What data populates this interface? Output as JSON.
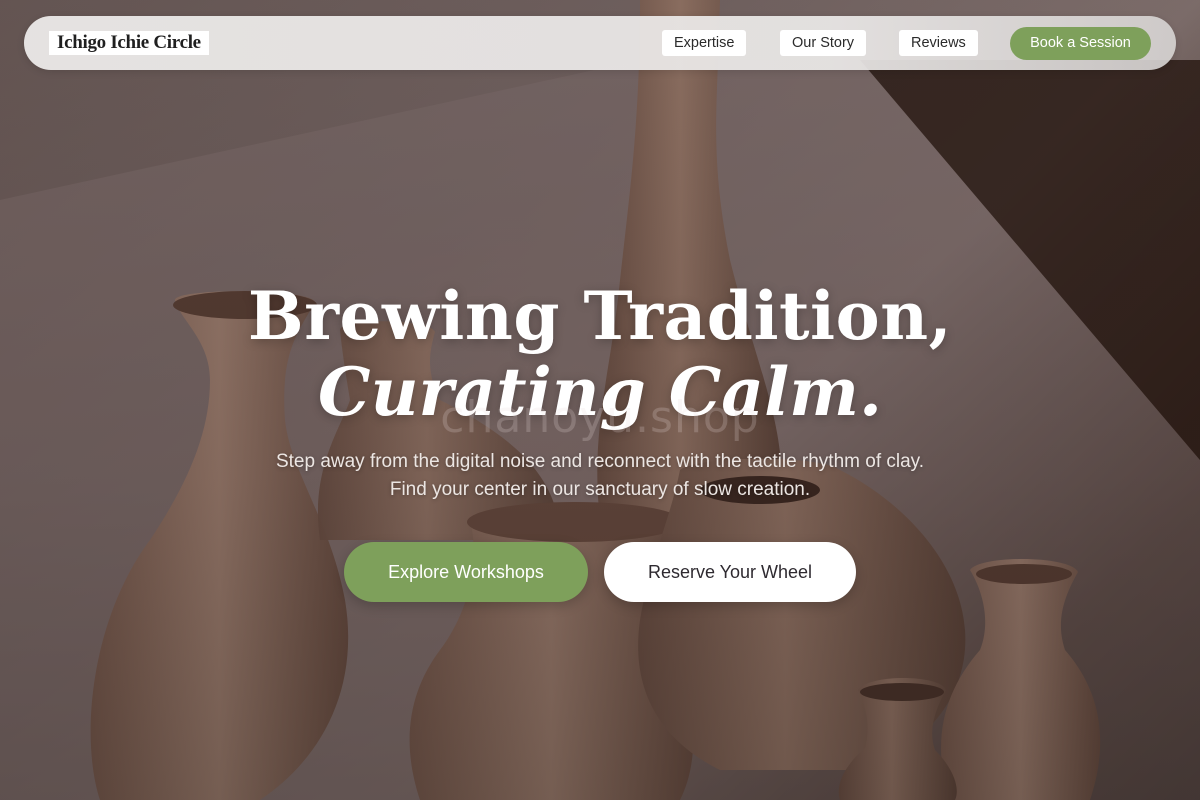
{
  "nav": {
    "brand": "Ichigo Ichie Circle",
    "links": [
      {
        "label": "Expertise"
      },
      {
        "label": "Our Story"
      },
      {
        "label": "Reviews"
      }
    ],
    "cta_label": "Book a Session"
  },
  "hero": {
    "title_line1": "Brewing Tradition,",
    "title_line2": "Curating Calm.",
    "watermark": "chanoyu.shop",
    "subtitle": "Step away from the digital noise and reconnect with the tactile rhythm of clay. Find your center in our sanctuary of slow creation.",
    "primary_button": "Explore Workshops",
    "secondary_button": "Reserve Your Wheel"
  },
  "colors": {
    "accent_green": "#7ea05b",
    "nav_background": "#eceae9",
    "clay": "#8c6d5f"
  }
}
